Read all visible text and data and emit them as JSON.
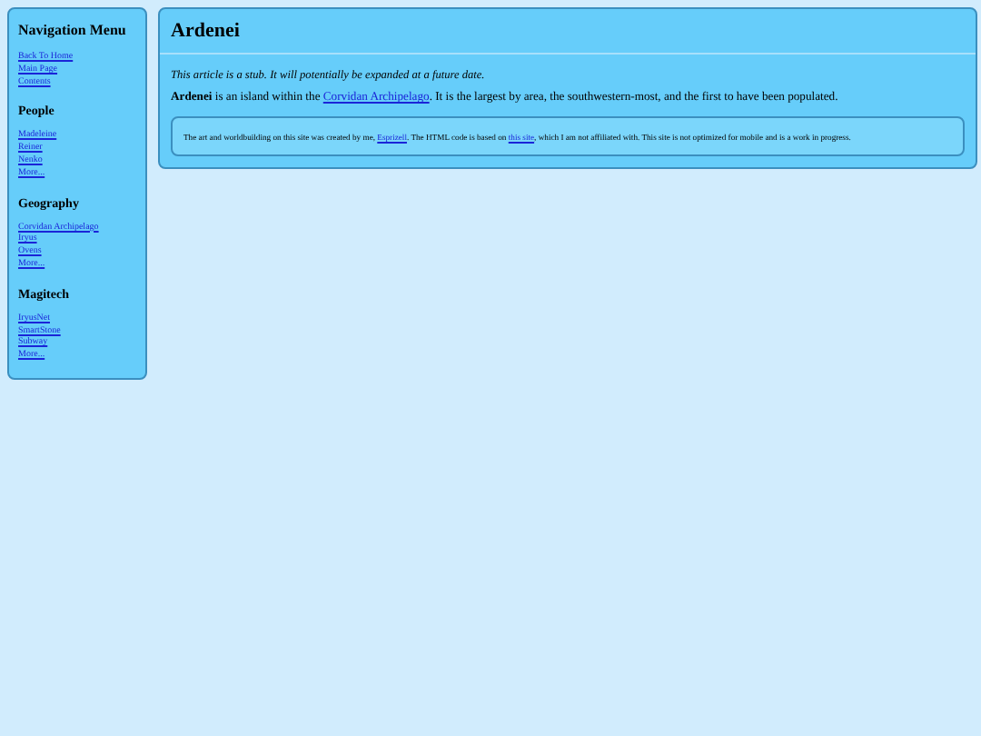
{
  "sidebar": {
    "title": "Navigation Menu",
    "top_links": [
      "Back To Home",
      "Main Page",
      "Contents"
    ],
    "sections": [
      {
        "heading": "People",
        "links": [
          "Madeleine",
          "Reiner",
          "Nenko",
          "More..."
        ]
      },
      {
        "heading": "Geography",
        "links": [
          "Corvidan Archipelago",
          "Iryus",
          "Ovens",
          "More..."
        ]
      },
      {
        "heading": "Magitech",
        "links": [
          "IryusNet",
          "SmartStone",
          "Subway",
          "More..."
        ]
      }
    ]
  },
  "article": {
    "title": "Ardenei",
    "stub_note": "This article is a stub. It will potentially be expanded at a future date.",
    "intro": [
      {
        "kind": "bold",
        "text": "Ardenei"
      },
      {
        "kind": "text",
        "text": " is an island within the "
      },
      {
        "kind": "link",
        "text": "Corvidan Archipelago"
      },
      {
        "kind": "text",
        "text": ". It is the largest by area, the southwestern-most, and the first to have been populated."
      }
    ],
    "footer": [
      {
        "kind": "text",
        "text": "The art and worldbuilding on this site was created by me, "
      },
      {
        "kind": "link",
        "text": "Esprizell"
      },
      {
        "kind": "text",
        "text": ". The HTML code is based on "
      },
      {
        "kind": "link",
        "text": "this site"
      },
      {
        "kind": "text",
        "text": ", which I am not affiliated with. This site is not optimized for mobile and is a work in progress."
      }
    ]
  }
}
